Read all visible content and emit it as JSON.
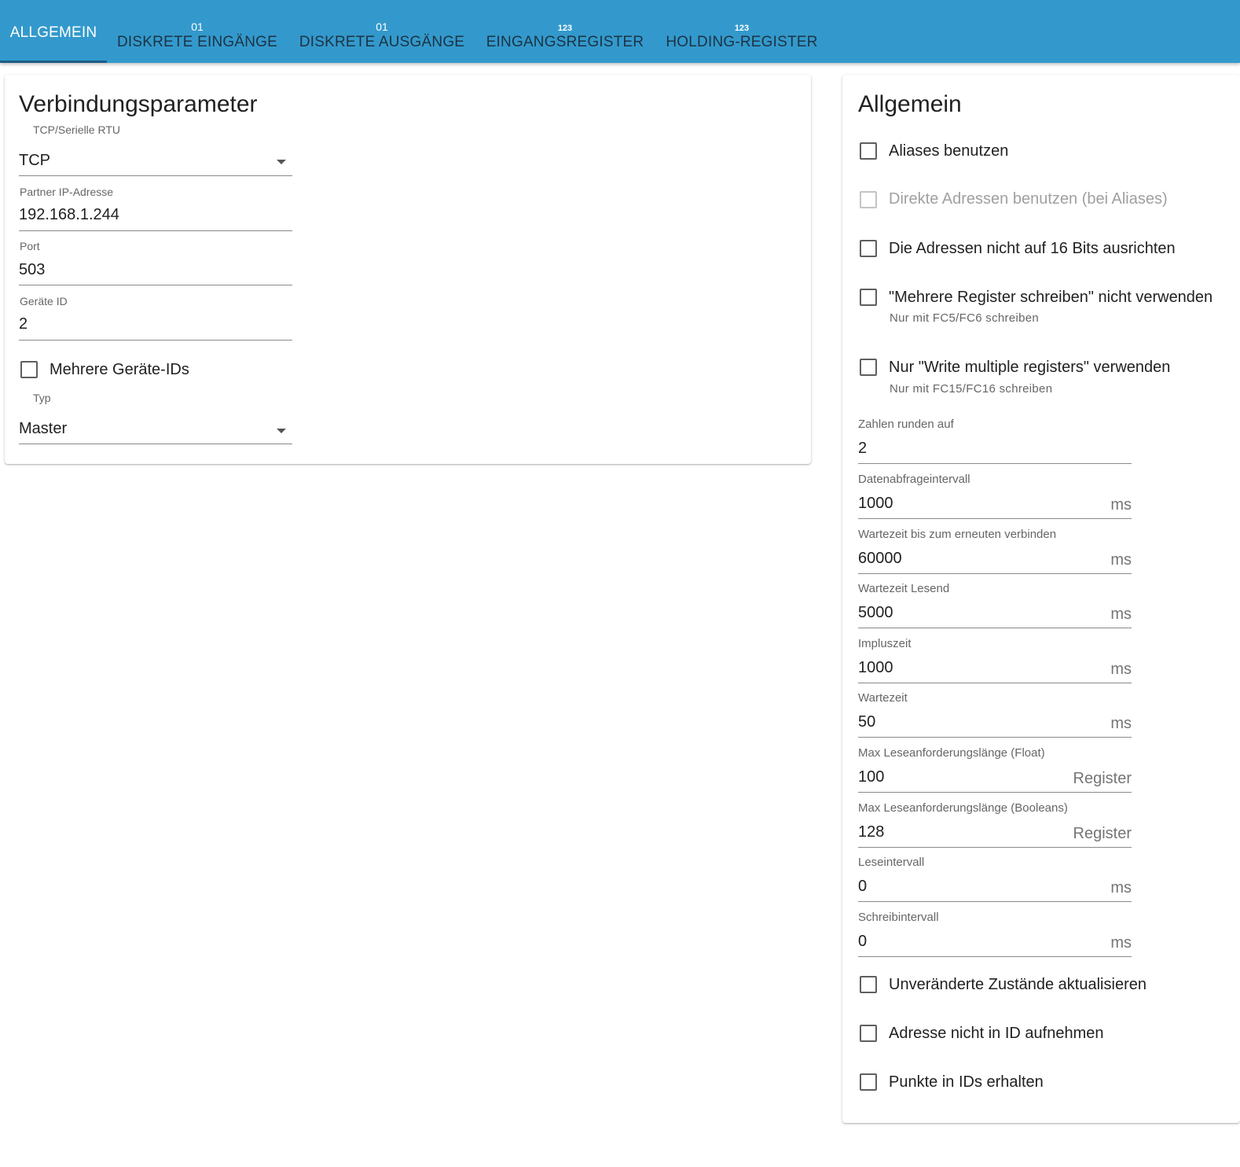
{
  "tabs": [
    {
      "icon": "",
      "label": "ALLGEMEIN"
    },
    {
      "icon": "01",
      "label": "DISKRETE EINGÄNGE"
    },
    {
      "icon": "01",
      "label": "DISKRETE AUSGÄNGE"
    },
    {
      "icon": "123",
      "label": "EINGANGSREGISTER"
    },
    {
      "icon": "123",
      "label": "HOLDING-REGISTER"
    }
  ],
  "connection": {
    "title": "Verbindungsparameter",
    "mode_label": "TCP/Serielle RTU",
    "mode_value": "TCP",
    "ip_label": "Partner IP-Adresse",
    "ip_value": "192.168.1.244",
    "port_label": "Port",
    "port_value": "503",
    "device_id_label": "Geräte ID",
    "device_id_value": "2",
    "multi_ids_label": "Mehrere Geräte-IDs",
    "type_label": "Typ",
    "type_value": "Master"
  },
  "general": {
    "title": "Allgemein",
    "checkboxes_top": [
      {
        "label": "Aliases benutzen",
        "hint": "",
        "disabled": false
      },
      {
        "label": "Direkte Adressen benutzen (bei Aliases)",
        "hint": "",
        "disabled": true
      },
      {
        "label": "Die Adressen nicht auf 16 Bits ausrichten",
        "hint": "",
        "disabled": false
      },
      {
        "label": "\"Mehrere Register schreiben\" nicht verwenden",
        "hint": "Nur mit FC5/FC6 schreiben",
        "disabled": false
      },
      {
        "label": "Nur \"Write multiple registers\" verwenden",
        "hint": "Nur mit FC15/FC16 schreiben",
        "disabled": false
      }
    ],
    "fields": [
      {
        "label": "Zahlen runden auf",
        "value": "2",
        "unit": ""
      },
      {
        "label": "Datenabfrageintervall",
        "value": "1000",
        "unit": "ms"
      },
      {
        "label": "Wartezeit bis zum erneuten verbinden",
        "value": "60000",
        "unit": "ms"
      },
      {
        "label": "Wartezeit Lesend",
        "value": "5000",
        "unit": "ms"
      },
      {
        "label": "Impluszeit",
        "value": "1000",
        "unit": "ms"
      },
      {
        "label": "Wartezeit",
        "value": "50",
        "unit": "ms"
      },
      {
        "label": "Max Leseanforderungslänge (Float)",
        "value": "100",
        "unit": "Register"
      },
      {
        "label": "Max Leseanforderungslänge (Booleans)",
        "value": "128",
        "unit": "Register"
      },
      {
        "label": "Leseintervall",
        "value": "0",
        "unit": "ms"
      },
      {
        "label": "Schreibintervall",
        "value": "0",
        "unit": "ms"
      }
    ],
    "checkboxes_bottom": [
      {
        "label": "Unveränderte Zustände aktualisieren"
      },
      {
        "label": "Adresse nicht in ID aufnehmen"
      },
      {
        "label": "Punkte in IDs erhalten"
      }
    ]
  },
  "colors": {
    "tabbar": "#3399cc",
    "tab_indicator": "#1c5d87",
    "inactive_tab_text": "#1c3344"
  }
}
